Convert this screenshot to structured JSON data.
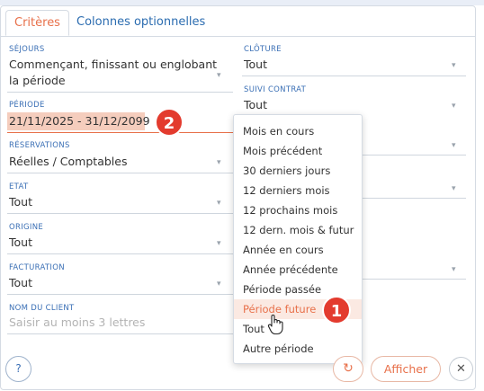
{
  "tabs": [
    {
      "label": "Critères"
    },
    {
      "label": "Colonnes optionnelles"
    }
  ],
  "left_fields": {
    "sejours": {
      "label": "SÉJOURS",
      "value_line1": "Commençant, finissant ou englobant",
      "value_line2": "la période"
    },
    "periode": {
      "label": "PÉRIODE",
      "value": "21/11/2025 - 31/12/2099"
    },
    "reservations": {
      "label": "RÉSERVATIONS",
      "value": "Réelles / Comptables"
    },
    "etat": {
      "label": "ETAT",
      "value": "Tout"
    },
    "origine": {
      "label": "ORIGINE",
      "value": "Tout"
    },
    "facturation": {
      "label": "FACTURATION",
      "value": "Tout"
    },
    "nom_client": {
      "label": "NOM DU CLIENT",
      "placeholder": "Saisir au moins 3 lettres"
    }
  },
  "right_fields": {
    "cloture": {
      "label": "CLÔTURE",
      "value": "Tout"
    },
    "suivi_contrat": {
      "label": "SUIVI CONTRAT",
      "value": "Tout"
    },
    "extra1": {
      "value": "…"
    },
    "extra2": {
      "value": "…"
    },
    "extra3": {
      "value": "…"
    }
  },
  "dropdown": {
    "items": [
      "Mois en cours",
      "Mois précédent",
      "30 derniers jours",
      "12 derniers mois",
      "12 prochains mois",
      "12 dern. mois & futur",
      "Année en cours",
      "Année précédente",
      "Période passée",
      "Période future",
      "Tout",
      "Autre période"
    ],
    "highlighted": "Période future"
  },
  "badges": {
    "one": "1",
    "two": "2"
  },
  "footer": {
    "help_label": "?",
    "reset_icon": "refresh-icon",
    "afficher_label": "Afficher",
    "close_icon": "close-icon"
  },
  "colors": {
    "accent": "#e8704a",
    "label_blue": "#3a6fb5",
    "badge_red": "#e33b2e"
  }
}
